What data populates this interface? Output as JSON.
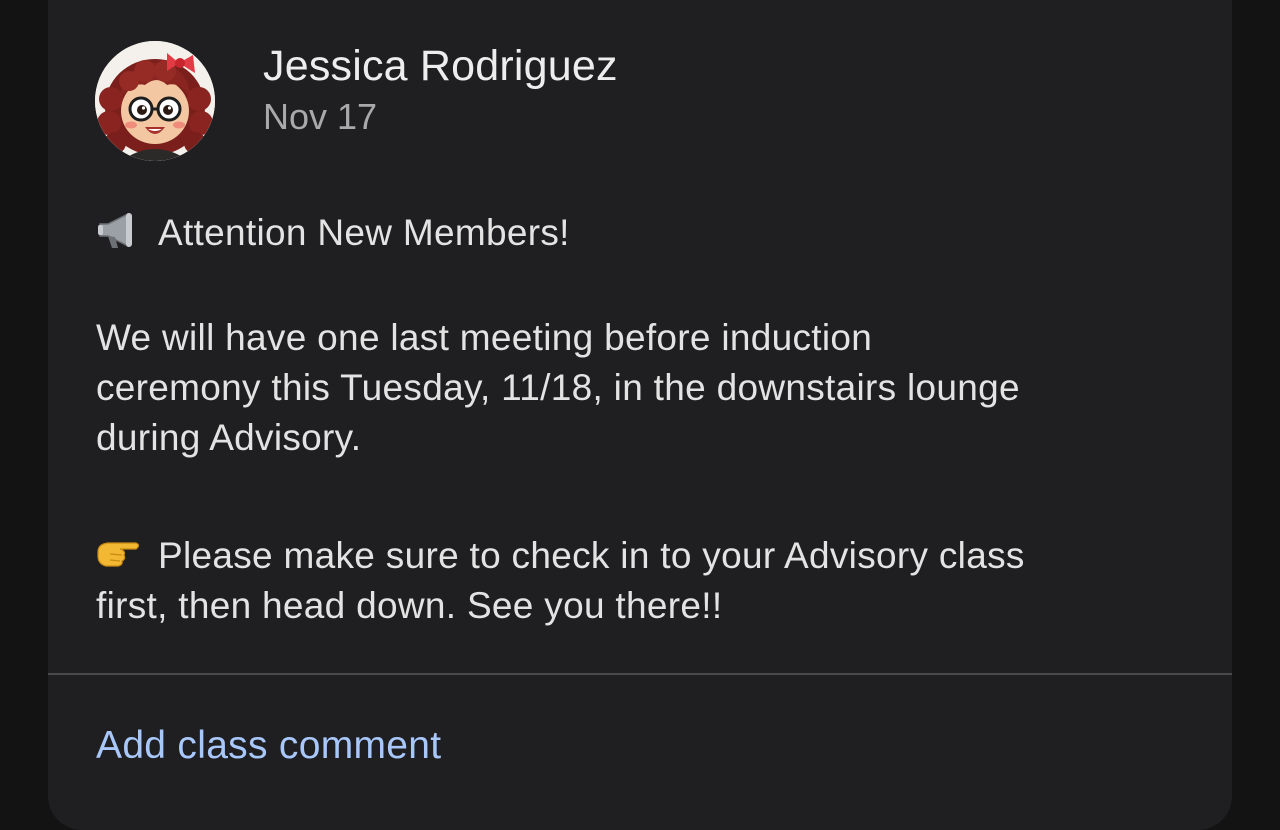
{
  "post": {
    "author": "Jessica Rodriguez",
    "date": "Nov 17",
    "avatar_icon": "cartoon-girl-avatar",
    "headline_icon": "megaphone-icon",
    "headline": "Attention New Members!",
    "paragraph_lines": [
      "We will have one last  meeting before induction",
      "ceremony this Tuesday, 11/18, in the downstairs lounge",
      "during Advisory."
    ],
    "pointer_icon": "pointing-hand-icon",
    "reminder_lines": [
      "Please make sure to check in to your Advisory class",
      "first, then head down. See you there!!"
    ]
  },
  "comment": {
    "label": "Add class comment"
  },
  "colors": {
    "card_background": "#1f1f21",
    "page_background": "#131314",
    "link": "#a8c7fa",
    "text": "#e3e3e3",
    "muted": "#a9a9ab"
  }
}
